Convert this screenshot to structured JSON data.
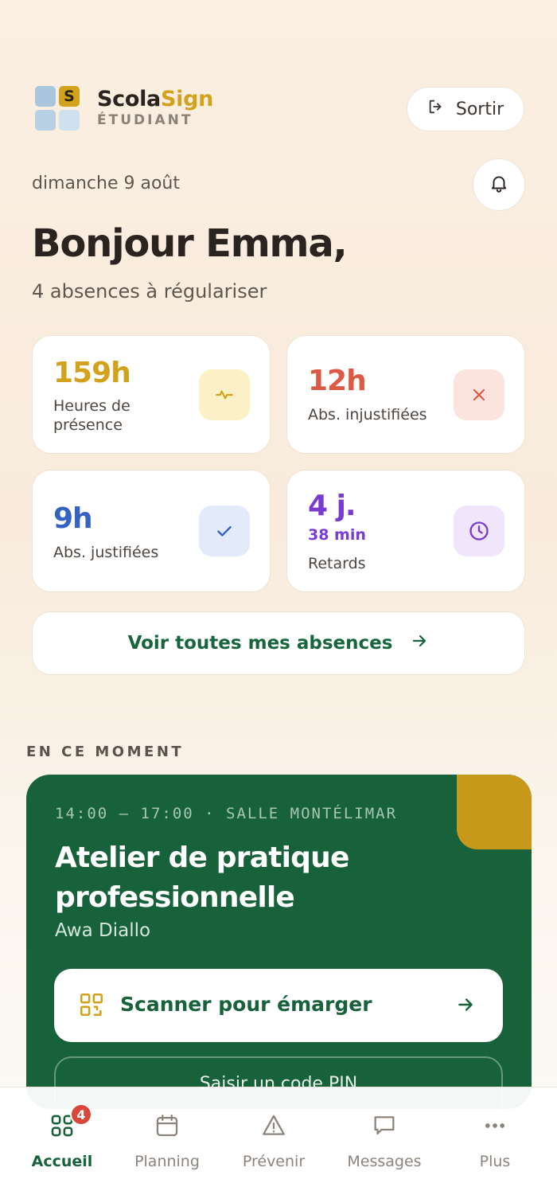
{
  "brand": {
    "name_part1": "Scola",
    "name_part2": "Sign",
    "logo_letter": "S",
    "subtitle": "ÉTUDIANT"
  },
  "header": {
    "logout_label": "Sortir"
  },
  "greeting": {
    "date": "dimanche 9 août",
    "title": "Bonjour Emma,",
    "subtitle": "4 absences à régulariser"
  },
  "stats": [
    {
      "value": "159h",
      "label": "Heures de présence",
      "icon": "pulse-icon",
      "color": "#d3a21d",
      "icon_bg": "#fcf0c6"
    },
    {
      "value": "12h",
      "label": "Abs. injustifiées",
      "icon": "close-icon",
      "color": "#dc5a44",
      "icon_bg": "#fbe3de"
    },
    {
      "value": "9h",
      "label": "Abs. justifiées",
      "icon": "check-icon",
      "color": "#3463c4",
      "icon_bg": "#e3ebfa"
    },
    {
      "value": "4 j.",
      "sub": "38 min",
      "label": "Retards",
      "icon": "clock-icon",
      "color": "#7a3bd2",
      "icon_bg": "#efe6fb"
    }
  ],
  "all_absences_label": "Voir toutes mes absences",
  "current": {
    "section_title": "EN CE MOMENT",
    "time": "14:00 — 17:00 · SALLE MONTÉLIMAR",
    "title": "Atelier de pratique professionnelle",
    "teacher": "Awa Diallo",
    "scan_label": "Scanner pour émarger",
    "pin_label": "Saisir un code PIN"
  },
  "nav": {
    "items": [
      {
        "label": "Accueil",
        "icon": "grid-icon",
        "active": true,
        "badge": "4"
      },
      {
        "label": "Planning",
        "icon": "calendar-icon"
      },
      {
        "label": "Prévenir",
        "icon": "warning-icon"
      },
      {
        "label": "Messages",
        "icon": "message-icon"
      },
      {
        "label": "Plus",
        "icon": "more-icon"
      }
    ]
  },
  "colors": {
    "primary_green": "#17613b",
    "accent_gold": "#d3a21d",
    "badge_red": "#d9473a"
  }
}
